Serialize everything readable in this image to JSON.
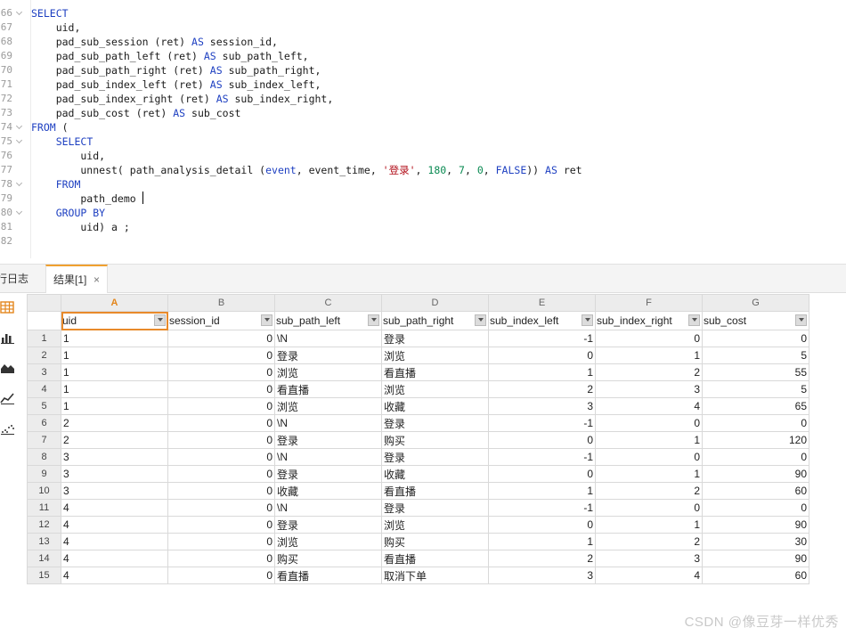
{
  "editor": {
    "lines": [
      {
        "no": "66",
        "fold": true,
        "html": "<span class=\"kw\">SELECT</span>"
      },
      {
        "no": "67",
        "fold": false,
        "html": "    uid,"
      },
      {
        "no": "68",
        "fold": false,
        "html": "    pad_sub_session (ret) <span class=\"kw\">AS</span> session_id,"
      },
      {
        "no": "69",
        "fold": false,
        "html": "    pad_sub_path_left (ret) <span class=\"kw\">AS</span> sub_path_left,"
      },
      {
        "no": "70",
        "fold": false,
        "html": "    pad_sub_path_right (ret) <span class=\"kw\">AS</span> sub_path_right,"
      },
      {
        "no": "71",
        "fold": false,
        "html": "    pad_sub_index_left (ret) <span class=\"kw\">AS</span> sub_index_left,"
      },
      {
        "no": "72",
        "fold": false,
        "html": "    pad_sub_index_right (ret) <span class=\"kw\">AS</span> sub_index_right,"
      },
      {
        "no": "73",
        "fold": false,
        "html": "    pad_sub_cost (ret) <span class=\"kw\">AS</span> sub_cost"
      },
      {
        "no": "74",
        "fold": true,
        "html": "<span class=\"kw\">FROM</span> ("
      },
      {
        "no": "75",
        "fold": true,
        "html": "    <span class=\"kw\">SELECT</span>"
      },
      {
        "no": "76",
        "fold": false,
        "html": "        uid,"
      },
      {
        "no": "77",
        "fold": false,
        "html": "        unnest( path_analysis_detail (<span class=\"kw\">event</span>, event_time, <span class=\"str\">'登录'</span>, <span class=\"num\">180</span>, <span class=\"num\">7</span>, <span class=\"num\">0</span>, <span class=\"kw\">FALSE</span>)) <span class=\"kw\">AS</span> ret"
      },
      {
        "no": "78",
        "fold": true,
        "html": "    <span class=\"kw\">FROM</span>"
      },
      {
        "no": "79",
        "fold": false,
        "html": "        path_demo <span class=\"caret\"></span>"
      },
      {
        "no": "80",
        "fold": true,
        "html": "    <span class=\"kw\">GROUP BY</span>"
      },
      {
        "no": "81",
        "fold": false,
        "html": "        uid) a ;"
      },
      {
        "no": "82",
        "fold": false,
        "html": ""
      }
    ]
  },
  "tabs": {
    "log_label": "行日志",
    "result_label": "结果[1]",
    "close_glyph": "×"
  },
  "grid": {
    "column_letters": [
      "A",
      "B",
      "C",
      "D",
      "E",
      "F",
      "G"
    ],
    "fields": [
      "uid",
      "session_id",
      "sub_path_left",
      "sub_path_right",
      "sub_index_left",
      "sub_index_right",
      "sub_cost"
    ],
    "rows": [
      [
        "1",
        "0",
        "\\N",
        "登录",
        "-1",
        "0",
        "0"
      ],
      [
        "1",
        "0",
        "登录",
        "浏览",
        "0",
        "1",
        "5"
      ],
      [
        "1",
        "0",
        "浏览",
        "看直播",
        "1",
        "2",
        "55"
      ],
      [
        "1",
        "0",
        "看直播",
        "浏览",
        "2",
        "3",
        "5"
      ],
      [
        "1",
        "0",
        "浏览",
        "收藏",
        "3",
        "4",
        "65"
      ],
      [
        "2",
        "0",
        "\\N",
        "登录",
        "-1",
        "0",
        "0"
      ],
      [
        "2",
        "0",
        "登录",
        "购买",
        "0",
        "1",
        "120"
      ],
      [
        "3",
        "0",
        "\\N",
        "登录",
        "-1",
        "0",
        "0"
      ],
      [
        "3",
        "0",
        "登录",
        "收藏",
        "0",
        "1",
        "90"
      ],
      [
        "3",
        "0",
        "收藏",
        "看直播",
        "1",
        "2",
        "60"
      ],
      [
        "4",
        "0",
        "\\N",
        "登录",
        "-1",
        "0",
        "0"
      ],
      [
        "4",
        "0",
        "登录",
        "浏览",
        "0",
        "1",
        "90"
      ],
      [
        "4",
        "0",
        "浏览",
        "购买",
        "1",
        "2",
        "30"
      ],
      [
        "4",
        "0",
        "购买",
        "看直播",
        "2",
        "3",
        "90"
      ],
      [
        "4",
        "0",
        "看直播",
        "取消下单",
        "3",
        "4",
        "60"
      ]
    ]
  },
  "sidebar": {
    "icons": [
      "table-view-icon",
      "bar-chart-icon",
      "area-chart-icon",
      "line-chart-icon",
      "scatter-chart-icon"
    ]
  },
  "colors": {
    "keyword": "#1d3fc1",
    "string": "#b3121d",
    "number": "#0a8a52",
    "accent": "#e88a2b"
  },
  "watermark": "CSDN @像豆芽一样优秀"
}
